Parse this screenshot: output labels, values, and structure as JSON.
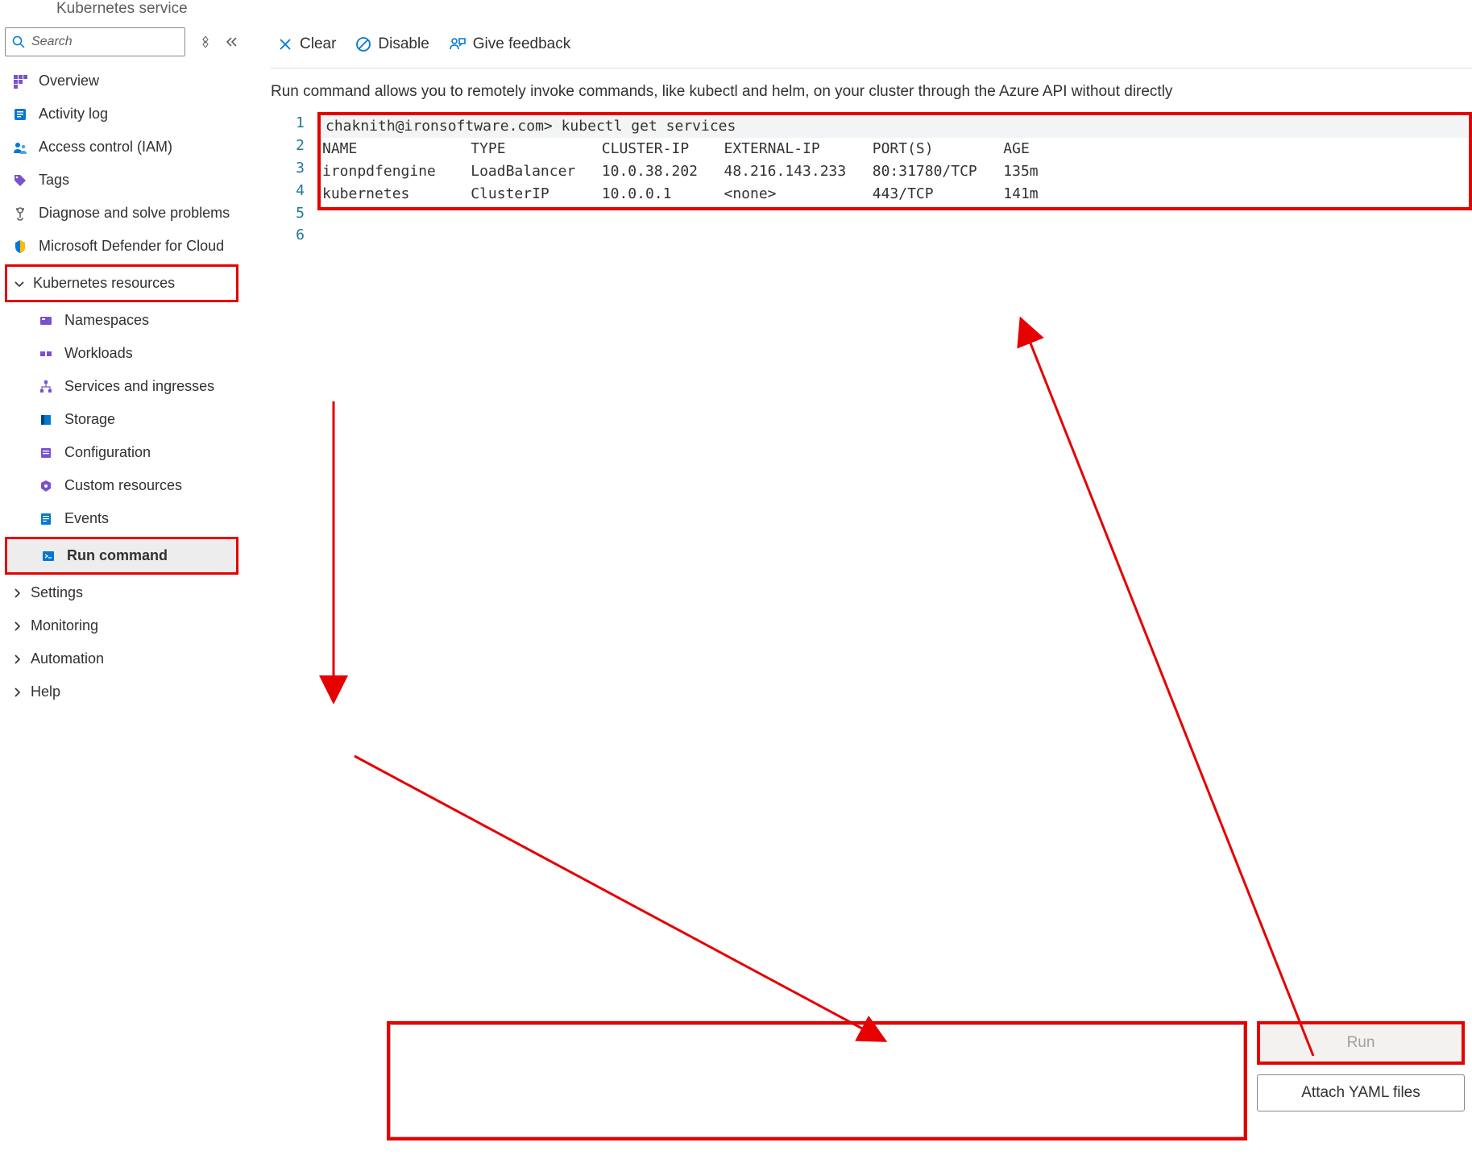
{
  "header": {
    "service_type": "Kubernetes service"
  },
  "search": {
    "placeholder": "Search"
  },
  "sidebar": {
    "overview": "Overview",
    "activity_log": "Activity log",
    "access_control": "Access control (IAM)",
    "tags": "Tags",
    "diagnose": "Diagnose and solve problems",
    "defender": "Microsoft Defender for Cloud",
    "kubernetes_resources": "Kubernetes resources",
    "namespaces": "Namespaces",
    "workloads": "Workloads",
    "services_ingresses": "Services and ingresses",
    "storage": "Storage",
    "configuration": "Configuration",
    "custom_resources": "Custom resources",
    "events": "Events",
    "run_command": "Run command",
    "settings": "Settings",
    "monitoring": "Monitoring",
    "automation": "Automation",
    "help": "Help"
  },
  "toolbar": {
    "clear": "Clear",
    "disable": "Disable",
    "feedback": "Give feedback"
  },
  "description": "Run command allows you to remotely invoke commands, like kubectl and helm, on your cluster through the Azure API without directly",
  "terminal": {
    "line_numbers": [
      "1",
      "2",
      "3",
      "4",
      "5",
      "6"
    ],
    "prompt": "chaknith@ironsoftware.com> kubectl get services",
    "columns": "NAME             TYPE           CLUSTER-IP    EXTERNAL-IP      PORT(S)        AGE",
    "row1": "ironpdfengine    LoadBalancer   10.0.38.202   48.216.143.233   80:31780/TCP   135m",
    "row2": "kubernetes       ClusterIP      10.0.0.1      <none>           443/TCP        141m"
  },
  "buttons": {
    "run": "Run",
    "attach_yaml": "Attach YAML files"
  }
}
